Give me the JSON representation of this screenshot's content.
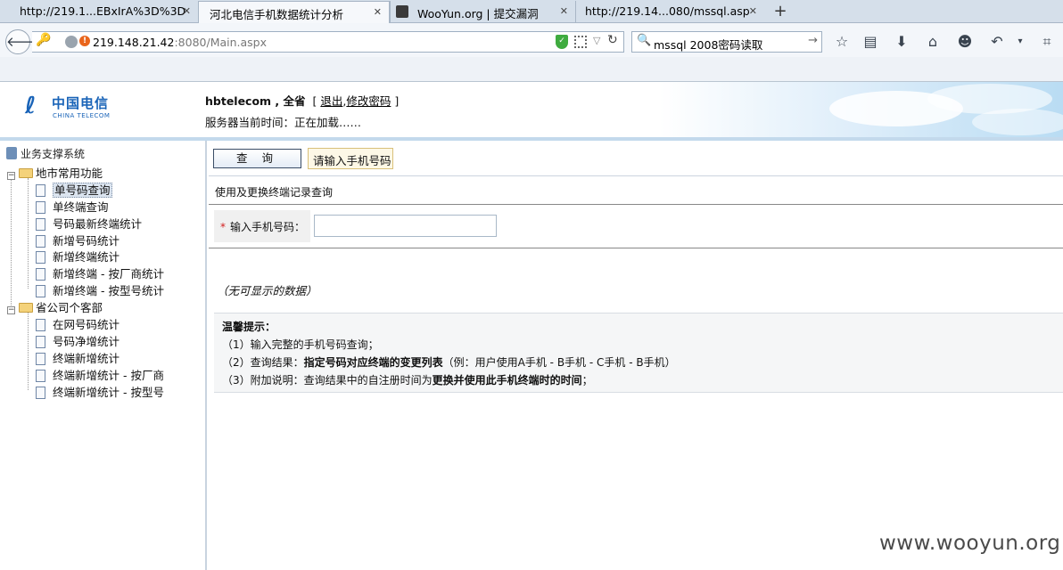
{
  "browser": {
    "tabs": [
      {
        "label": "http://219.1...EBxIrA%3D%3D"
      },
      {
        "label": "河北电信手机数据统计分析",
        "active": true
      },
      {
        "label": "WooYun.org | 提交漏洞"
      },
      {
        "label": "http://219.14...080/mssql.asp"
      }
    ],
    "url": {
      "host": "219.148.21.42",
      "rest": ":8080/Main.aspx"
    },
    "search_value": "mssql 2008密码读取"
  },
  "header": {
    "logo_cn": "中国电信",
    "logo_en": "CHINA TELECOM",
    "user": "hbtelecom , 全省",
    "bracket_open": "[",
    "logout": "退出",
    "sep": ",",
    "change_password": "修改密码",
    "bracket_close": "]",
    "server_time": "服务器当前时间：正在加载……"
  },
  "sidebar": {
    "root": "业务支撑系统",
    "groups": [
      {
        "label": "地市常用功能",
        "items": [
          "单号码查询",
          "单终端查询",
          "号码最新终端统计",
          "新增号码统计",
          "新增终端统计",
          "新增终端 - 按厂商统计",
          "新增终端 - 按型号统计"
        ]
      },
      {
        "label": "省公司个客部",
        "items": [
          "在网号码统计",
          "号码净增统计",
          "终端新增统计",
          "终端新增统计 - 按厂商",
          "终端新增统计 - 按型号"
        ]
      }
    ]
  },
  "main": {
    "query_button": "查 询",
    "hint": "请输入手机号码",
    "subtitle": "使用及更换终端记录查询",
    "phone_required": "*",
    "phone_label": "输入手机号码：",
    "phone_value": "",
    "no_data": "（无可显示的数据）",
    "tips": {
      "title": "温馨提示：",
      "line1": "（1）输入完整的手机号码查询；",
      "line2_pre": "（2）查询结果：",
      "line2_bold": "指定号码对应终端的变更列表",
      "line2_post": "（例：用户使用A手机 - B手机 - C手机 - B手机）",
      "line3_pre": "（3）附加说明：查询结果中的自注册时间为",
      "line3_bold": "更换并使用此手机终端时的时间",
      "line3_post": "；"
    }
  },
  "watermark": "www.wooyun.org",
  "colors": {
    "brand_blue": "#1a64b8",
    "url_warning": "#e9651c",
    "shield_green": "#3fab3f"
  }
}
